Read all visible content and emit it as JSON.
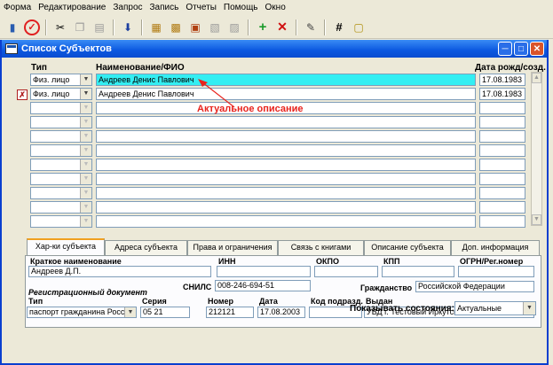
{
  "menu": [
    "Форма",
    "Редактирование",
    "Запрос",
    "Запись",
    "Отчеты",
    "Помощь",
    "Окно"
  ],
  "window": {
    "title": "Список Субъектов"
  },
  "grid": {
    "headers": {
      "type": "Тип",
      "name": "Наименование/ФИО",
      "date": "Дата рожд/созд."
    },
    "rows": [
      {
        "type": "Физ. лицо",
        "name": "Андреев Денис Павлович",
        "date": "17.08.1983"
      },
      {
        "type": "Физ. лицо",
        "name": "Андреев Денис Павлович",
        "date": "17.08.1983"
      }
    ]
  },
  "annotation": "Актуальное описание",
  "tabs": [
    "Хар-ки субъекта",
    "Адреса субъекта",
    "Права и ограничения",
    "Связь с книгами",
    "Описание субъекта",
    "Доп. информация"
  ],
  "details": {
    "short_name_label": "Краткое наименование",
    "short_name": "Андреев Д.П.",
    "inn_label": "ИНН",
    "okpo_label": "ОКПО",
    "kpp_label": "КПП",
    "ogrn_label": "ОГРН/Рег.номер",
    "snils_label": "СНИЛС",
    "snils": "008-246-694-51",
    "citizenship_label": "Гражданство",
    "citizenship": "Российской Федерации",
    "reg_doc_label": "Регистрационный документ",
    "doc_type_label": "Тип",
    "doc_type": "паспорт гражданина Росси",
    "series_label": "Серия",
    "series": "05 21",
    "number_label": "Номер",
    "number": "212121",
    "date_label": "Дата",
    "date": "17.08.2003",
    "dept_code_label": "Код подразд.",
    "issued_label": "Выдан",
    "issued": "УВД г. Тестовый Иркутская область"
  },
  "show_states": {
    "label": "Показывать состояния:",
    "value": "Актуальные"
  }
}
